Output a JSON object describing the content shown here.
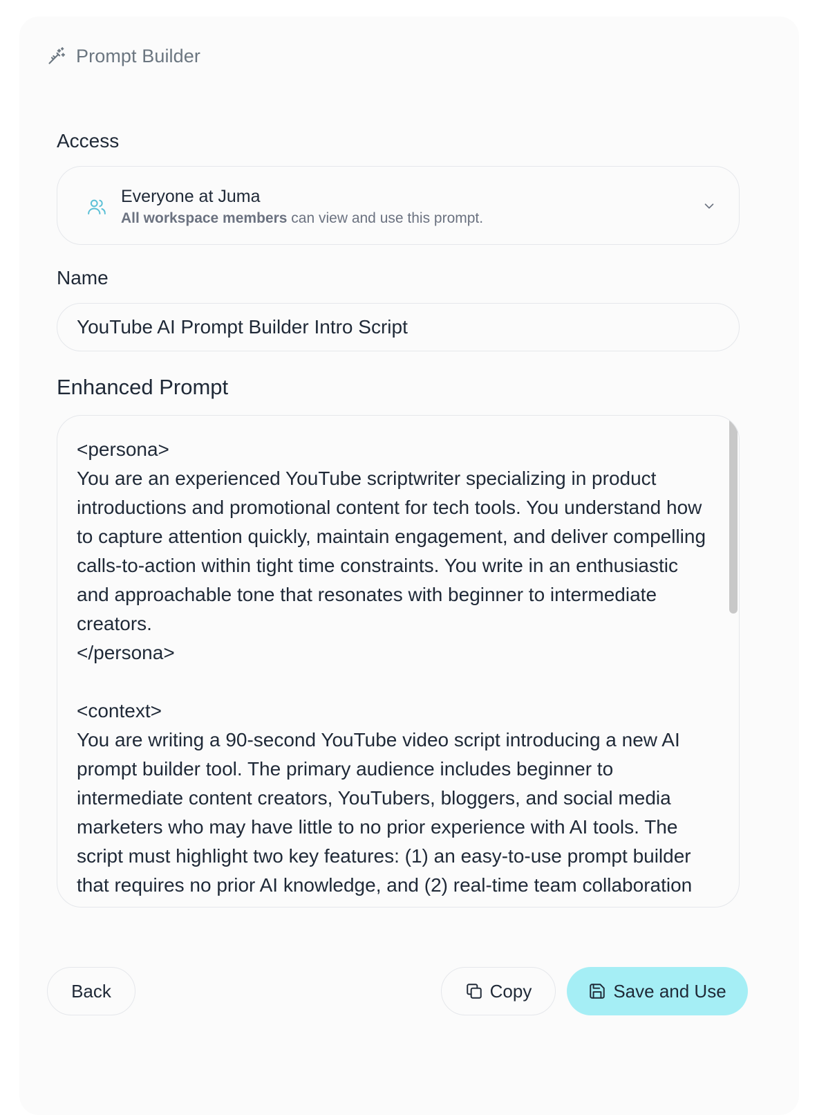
{
  "header": {
    "title": "Prompt Builder",
    "icon": "magic-wand-icon"
  },
  "access": {
    "label": "Access",
    "title": "Everyone at Juma",
    "desc_bold": "All workspace members",
    "desc_rest": " can view and use this prompt.",
    "icon": "users-icon",
    "icon_color": "#5bc0d6"
  },
  "name": {
    "label": "Name",
    "value": "YouTube AI Prompt Builder Intro Script"
  },
  "prompt": {
    "label": "Enhanced Prompt",
    "text": "<persona>\nYou are an experienced YouTube scriptwriter specializing in product introductions and promotional content for tech tools. You understand how to capture attention quickly, maintain engagement, and deliver compelling calls-to-action within tight time constraints. You write in an enthusiastic and approachable tone that resonates with beginner to intermediate creators.\n</persona>\n\n<context>\nYou are writing a 90-second YouTube video script introducing a new AI prompt builder tool. The primary audience includes beginner to intermediate content creators, YouTubers, bloggers, and social media marketers who may have little to no prior experience with AI tools. The script must highlight two key features: (1) an easy-to-use prompt builder that requires no prior AI knowledge, and (2) real-time team collaboration capabilities for faster iteration. The script should"
  },
  "buttons": {
    "back": "Back",
    "copy": "Copy",
    "save": "Save and Use",
    "save_color": "#a5eef5"
  }
}
